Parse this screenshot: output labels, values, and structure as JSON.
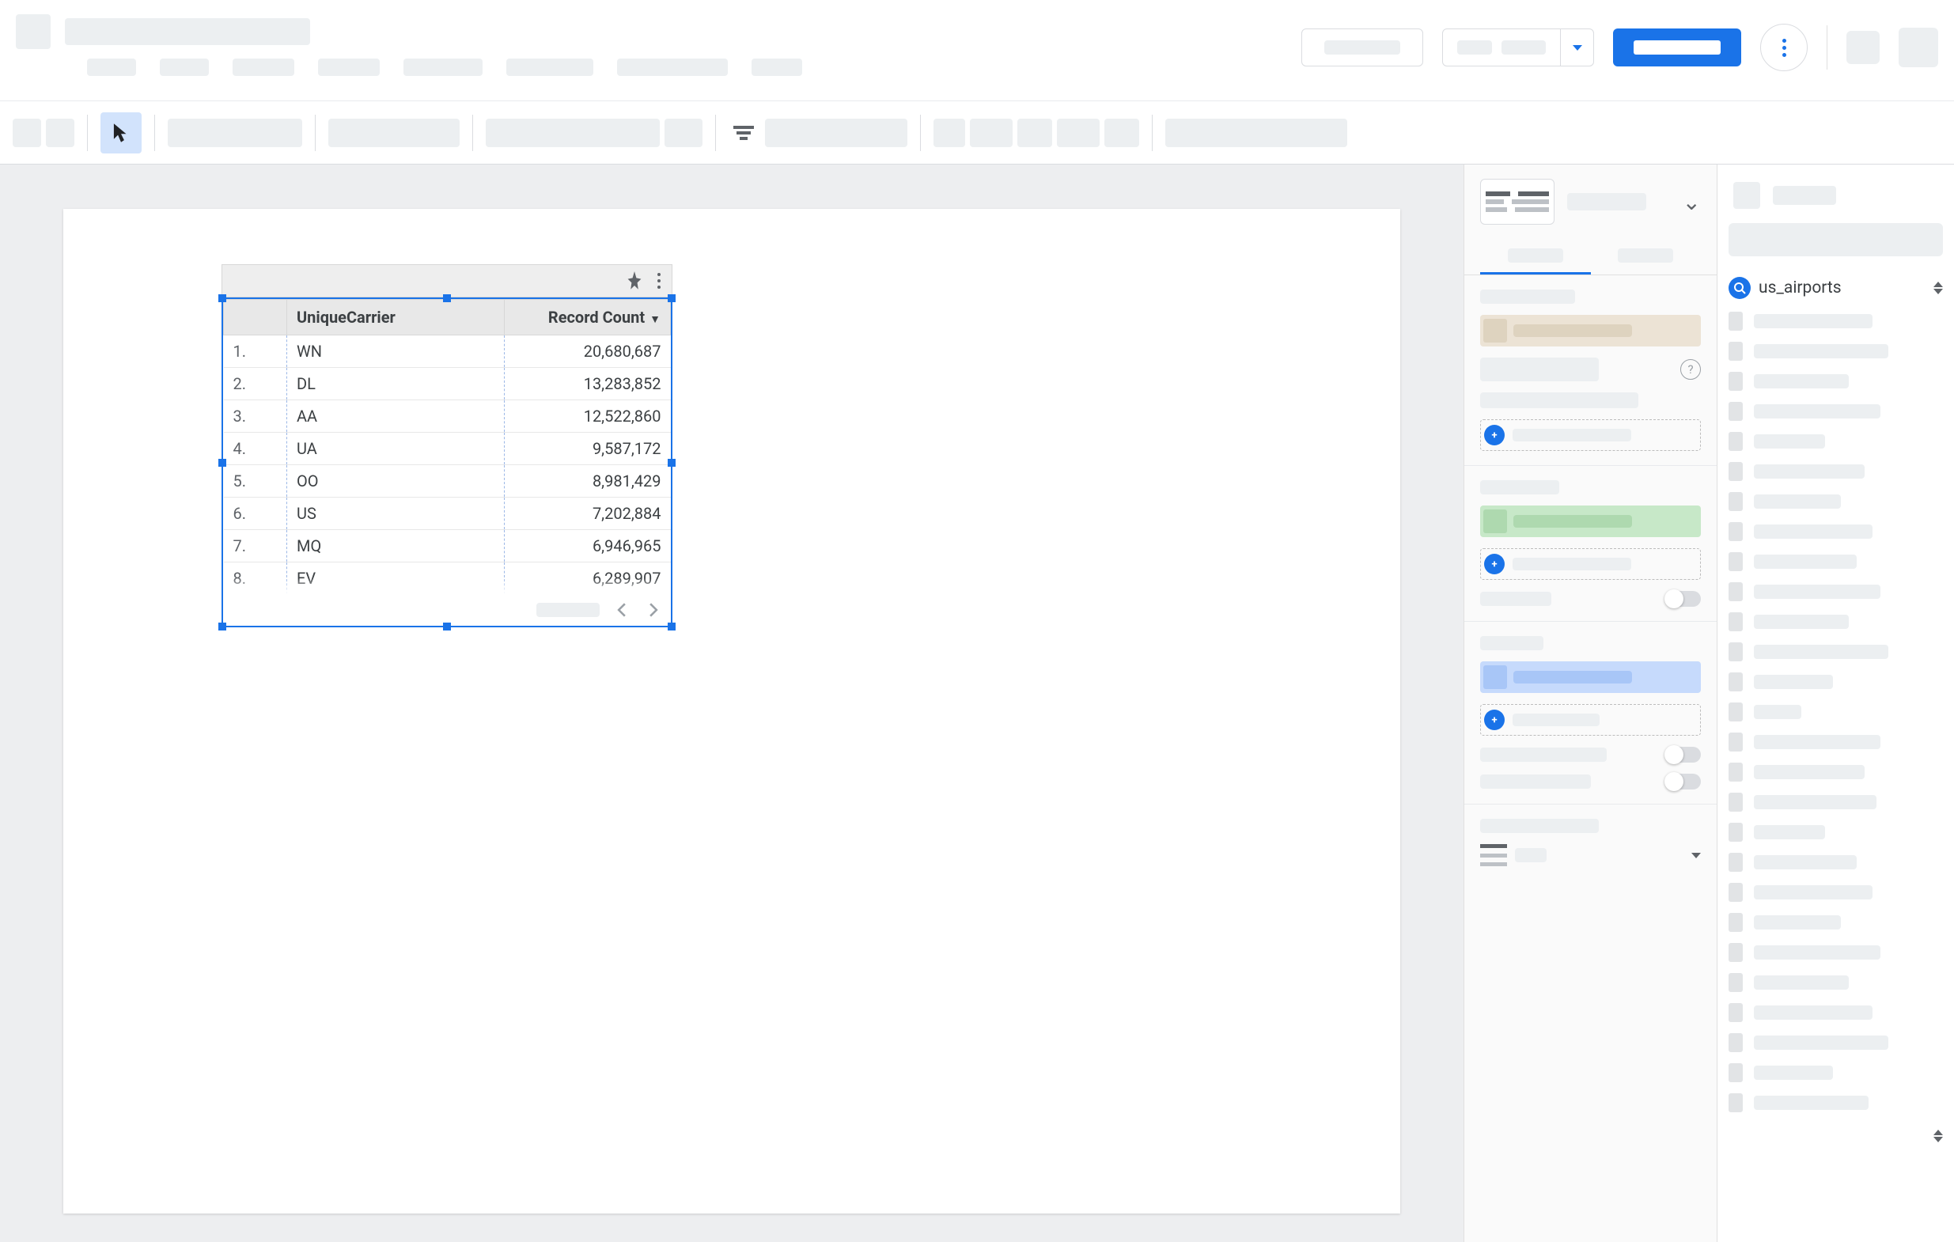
{
  "table": {
    "headers": {
      "dimension": "UniqueCarrier",
      "metric": "Record Count"
    },
    "rows": [
      {
        "n": "1.",
        "carrier": "WN",
        "count": "20,680,687"
      },
      {
        "n": "2.",
        "carrier": "DL",
        "count": "13,283,852"
      },
      {
        "n": "3.",
        "carrier": "AA",
        "count": "12,522,860"
      },
      {
        "n": "4.",
        "carrier": "UA",
        "count": "9,587,172"
      },
      {
        "n": "5.",
        "carrier": "OO",
        "count": "8,981,429"
      },
      {
        "n": "6.",
        "carrier": "US",
        "count": "7,202,884"
      },
      {
        "n": "7.",
        "carrier": "MQ",
        "count": "6,946,965"
      },
      {
        "n": "8.",
        "carrier": "EV",
        "count": "6,289,907"
      }
    ]
  },
  "data_source": {
    "name": "us_airports"
  },
  "icons": {
    "add": "+"
  }
}
